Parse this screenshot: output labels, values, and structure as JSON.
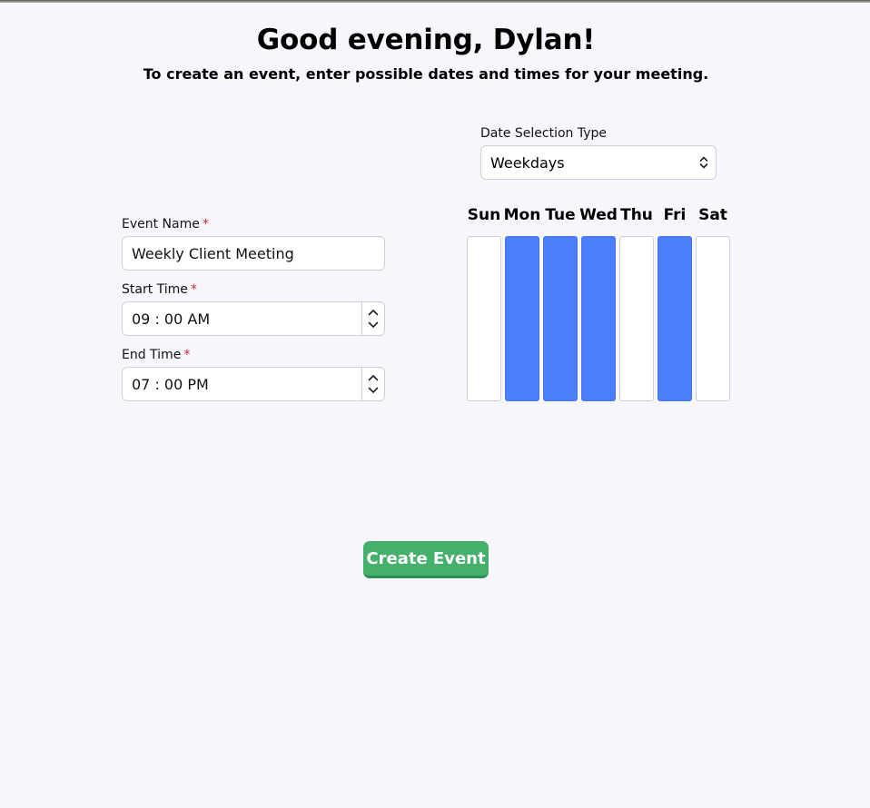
{
  "header": {
    "greeting": "Good evening, Dylan!",
    "subtitle": "To create an event, enter possible dates and times for your meeting."
  },
  "form": {
    "event_name": {
      "label": "Event Name",
      "required_mark": "*",
      "value": "Weekly Client Meeting"
    },
    "start_time": {
      "label": "Start Time",
      "required_mark": "*",
      "value": "09 : 00 AM"
    },
    "end_time": {
      "label": "End Time",
      "required_mark": "*",
      "value": "07 : 00 PM"
    },
    "date_selection_type": {
      "label": "Date Selection Type",
      "value": "Weekdays"
    }
  },
  "weekdays": [
    {
      "label": "Sun",
      "selected": false
    },
    {
      "label": "Mon",
      "selected": true
    },
    {
      "label": "Tue",
      "selected": true
    },
    {
      "label": "Wed",
      "selected": true
    },
    {
      "label": "Thu",
      "selected": false
    },
    {
      "label": "Fri",
      "selected": true
    },
    {
      "label": "Sat",
      "selected": false
    }
  ],
  "actions": {
    "create_label": "Create Event"
  },
  "colors": {
    "selected_day": "#4a7efb",
    "create_button": "#45b06b",
    "required_mark": "#d1242f",
    "background": "#f7f6fd"
  },
  "icons": {
    "spinner_up": "chevron-up-icon",
    "spinner_down": "chevron-down-icon",
    "select": "chevron-up-down-icon"
  }
}
